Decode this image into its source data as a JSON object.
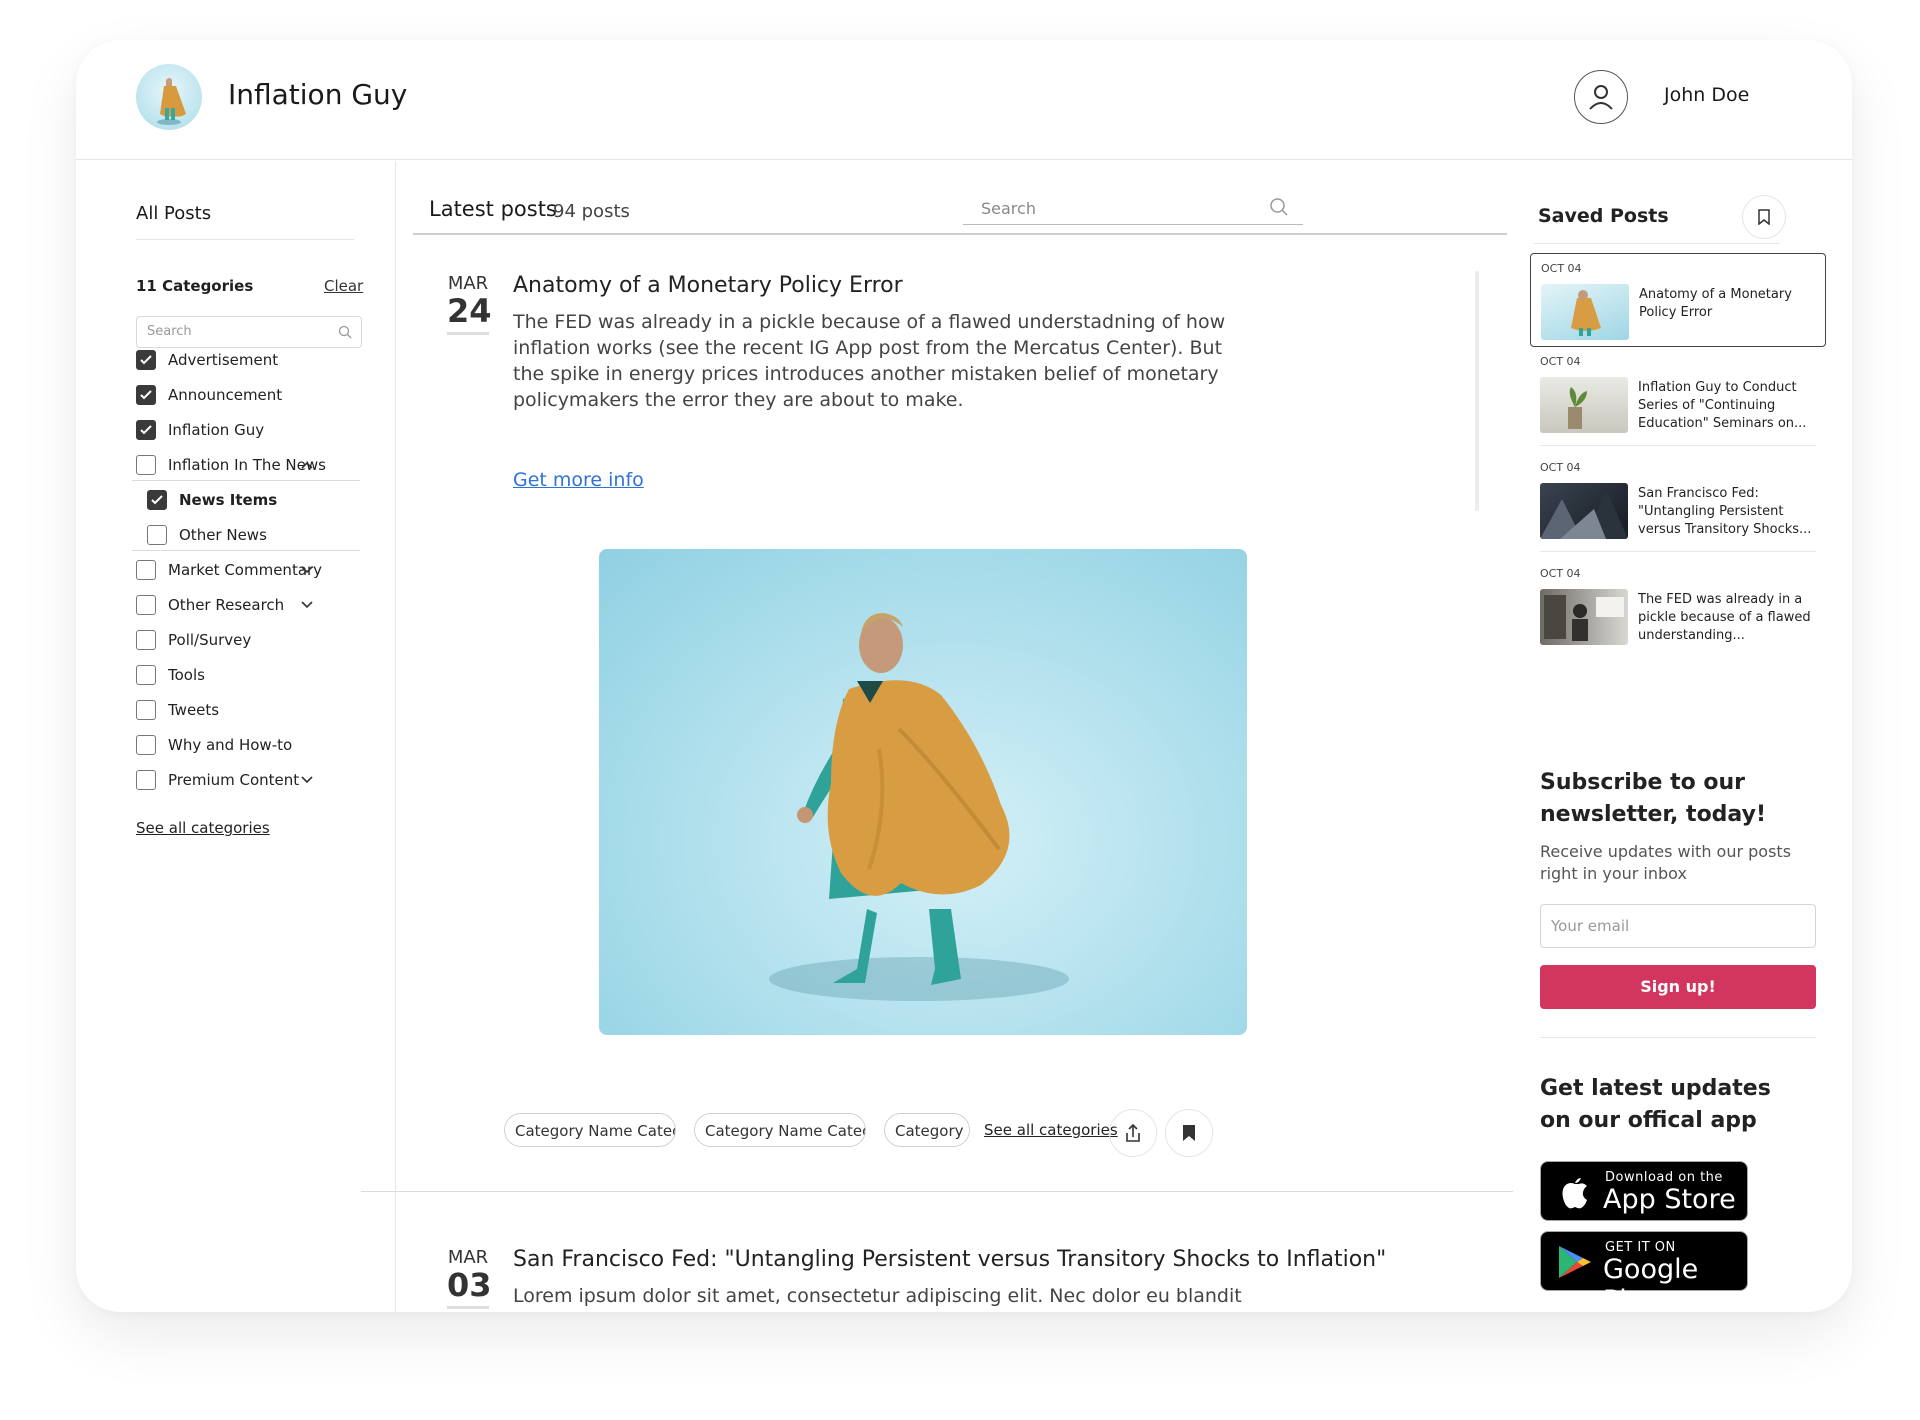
{
  "header": {
    "brand": "Inflation Guy",
    "user_name": "John Doe"
  },
  "sidebar": {
    "all_posts": "All Posts",
    "categories_title": "11 Categories",
    "clear_label": "Clear",
    "search_placeholder": "Search",
    "categories": [
      {
        "label": "Advertisement",
        "checked": true
      },
      {
        "label": "Announcement",
        "checked": true
      },
      {
        "label": "Inflation Guy",
        "checked": true
      },
      {
        "label": "Inflation In The News",
        "checked": false,
        "expanded": true,
        "children": [
          {
            "label": "News Items",
            "checked": true
          },
          {
            "label": "Other News",
            "checked": false
          }
        ]
      },
      {
        "label": "Market Commentary",
        "checked": false,
        "expandable": true
      },
      {
        "label": "Other Research",
        "checked": false,
        "expandable": true
      },
      {
        "label": "Poll/Survey",
        "checked": false
      },
      {
        "label": "Tools",
        "checked": false
      },
      {
        "label": "Tweets",
        "checked": false
      },
      {
        "label": "Why and How-to",
        "checked": false
      },
      {
        "label": "Premium Content",
        "checked": false,
        "expandable": true
      }
    ],
    "see_all": "See all categories"
  },
  "main": {
    "title": "Latest posts",
    "post_count": "94 posts",
    "search_placeholder": "Search",
    "posts": [
      {
        "month": "MAR",
        "day": "24",
        "title": "Anatomy of a Monetary Policy Error",
        "body": "The FED was already in a pickle because of a flawed understadning of how inflation works (see the recent IG App post from the Mercatus Center). But the spike in energy prices introduces another mistaken belief of monetary policymakers the error they are about to make.",
        "more_link": "Get more info",
        "chips": [
          "Category Name Category",
          "Category Name Category",
          "Category Na"
        ],
        "see_all_categories": "See all categories"
      },
      {
        "month": "MAR",
        "day": "03",
        "title": "San Francisco Fed: \"Untangling Persistent versus Transitory Shocks to Inflation\"",
        "body": "Lorem ipsum dolor sit amet, consectetur adipiscing elit. Nec dolor eu blandit suspendisse non in. Risus sed proin facilisis sed eget id. Vel amet mauris nibh mauris. Pulvinar quis amet, porta quis gravida. Libero eget porttitor pulvinar elit sed vit.  Libero eget porttitor pulvinar elit sed"
      }
    ]
  },
  "saved": {
    "title": "Saved Posts",
    "items": [
      {
        "date": "OCT 04",
        "title": "Anatomy of a Monetary Policy Error"
      },
      {
        "date": "OCT 04",
        "title": "Inflation Guy to Conduct Series of \"Continuing Education\" Seminars on..."
      },
      {
        "date": "OCT 04",
        "title": "San Francisco Fed: \"Untangling Persistent versus Transitory Shocks..."
      },
      {
        "date": "OCT 04",
        "title": "The FED was already in a pickle because of a flawed understanding..."
      }
    ]
  },
  "newsletter": {
    "title": "Subscribe to our newsletter, today!",
    "text": "Receive updates with our posts right in your inbox",
    "email_placeholder": "Your email",
    "button": "Sign up!"
  },
  "app": {
    "title": "Get latest updates on our offical app",
    "appstore_small": "Download on the",
    "appstore_big": "App Store",
    "googleplay_small": "GET IT ON",
    "googleplay_big": "Google Play"
  },
  "colors": {
    "accent": "#d2365e",
    "link": "#2f73d8",
    "checkbox": "#3a3a3a"
  }
}
